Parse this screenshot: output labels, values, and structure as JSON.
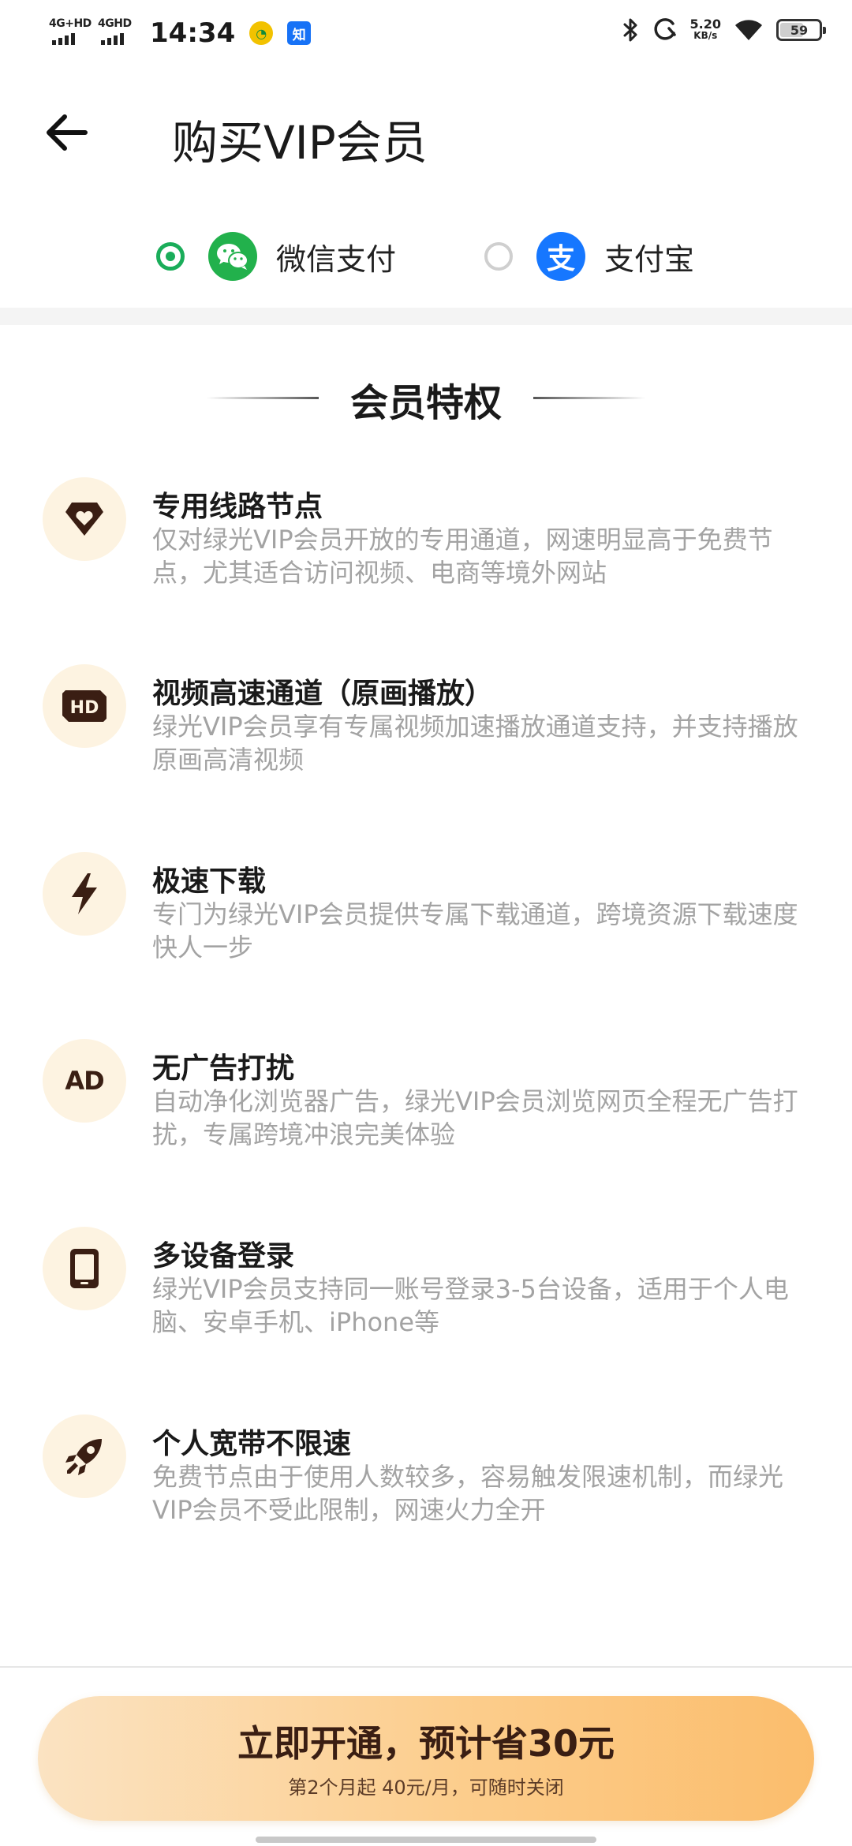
{
  "status_bar": {
    "network1": "4G+HD",
    "network2": "4GHD",
    "time": "14:34",
    "notif_app2": "知",
    "speed_value": "5.20",
    "speed_unit": "KB/s",
    "battery": "59"
  },
  "header": {
    "title": "购买VIP会员"
  },
  "payment": {
    "wechat_label": "微信支付",
    "alipay_label": "支付宝",
    "alipay_glyph": "支",
    "selected": "wechat"
  },
  "benefits": {
    "title": "会员特权",
    "items": [
      {
        "icon": "diamond-heart-icon",
        "title": "专用线路节点",
        "desc": "仅对绿光VIP会员开放的专用通道，网速明显高于免费节点，尤其适合访问视频、电商等境外网站"
      },
      {
        "icon": "hd-icon",
        "title": "视频高速通道（原画播放）",
        "desc": "绿光VIP会员享有专属视频加速播放通道支持，并支持播放原画高清视频"
      },
      {
        "icon": "lightning-icon",
        "title": "极速下载",
        "desc": "专门为绿光VIP会员提供专属下载通道，跨境资源下载速度快人一步"
      },
      {
        "icon": "ad-icon",
        "title": "无广告打扰",
        "desc": "自动净化浏览器广告，绿光VIP会员浏览网页全程无广告打扰，专属跨境冲浪完美体验"
      },
      {
        "icon": "tablet-icon",
        "title": "多设备登录",
        "desc": "绿光VIP会员支持同一账号登录3-5台设备，适用于个人电脑、安卓手机、iPhone等"
      },
      {
        "icon": "rocket-icon",
        "title": "个人宽带不限速",
        "desc": "免费节点由于使用人数较多，容易触发限速机制，而绿光VIP会员不受此限制，网速火力全开"
      }
    ],
    "hd_label": "HD",
    "ad_label": "AD"
  },
  "cta": {
    "title": "立即开通，预计省30元",
    "subtitle": "第2个月起 40元/月，可随时关闭"
  },
  "colors": {
    "accent_green": "#1aad5a",
    "icon_brown": "#3a1e13",
    "icon_bg": "#fdf3e1",
    "cta_gradient_end": "#fbbd6c"
  }
}
